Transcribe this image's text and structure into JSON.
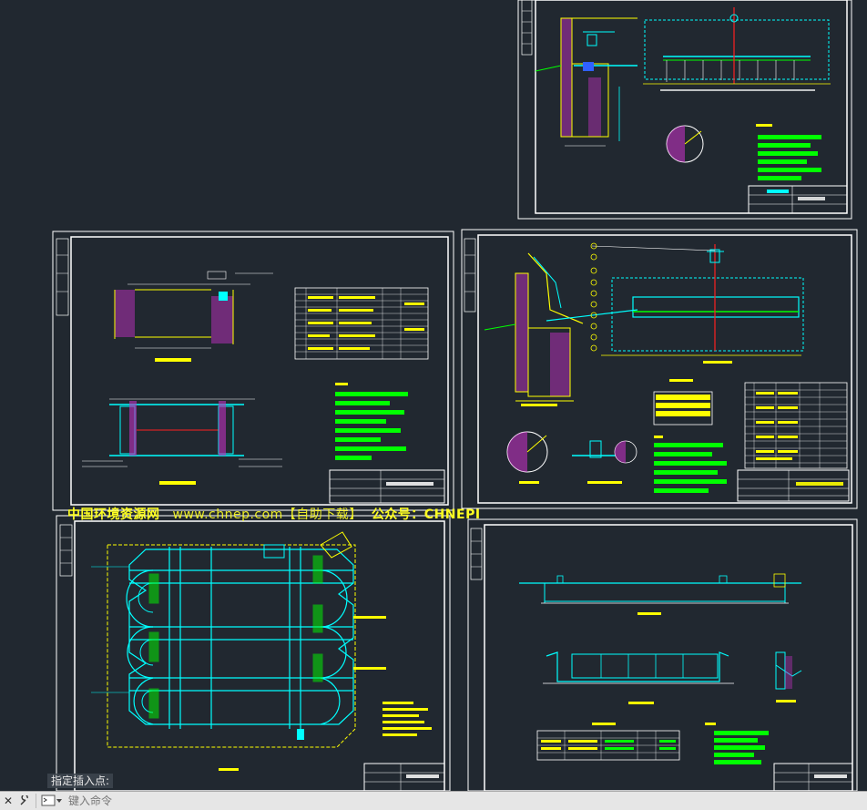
{
  "colors": {
    "background": "#212830",
    "sheet_border": "#ffffff",
    "cyan": "#00ffff",
    "yellow": "#ffff00",
    "green": "#00ff00",
    "magenta": "#ff00ff",
    "red": "#ff2020",
    "blue": "#3060ff",
    "watermark": "#ffff22"
  },
  "sheets": [
    {
      "id": "sheet-top-right",
      "title_block": "X2 排泥槽断面图"
    },
    {
      "id": "sheet-mid-left",
      "legend_title": "材 料 表",
      "notes_title": "说 明"
    },
    {
      "id": "sheet-mid-right",
      "legend_title": "材 料 表",
      "notes_title": "说 明",
      "title_block": "X2 刮泥机安装平面图"
    },
    {
      "id": "sheet-bottom-left",
      "title_block": "平面图"
    },
    {
      "id": "sheet-bottom-right",
      "legend_title": "材 料 表",
      "notes_title": "说 明"
    }
  ],
  "watermark": {
    "site_name": "中国环境资源网",
    "url": "www.chnep.com【自助下载】",
    "account": "公众号：CHNEPI"
  },
  "command_line": {
    "prompt": "指定插入点:",
    "placeholder": "键入命令",
    "close_label": "✕",
    "settings_label": "🔧"
  }
}
